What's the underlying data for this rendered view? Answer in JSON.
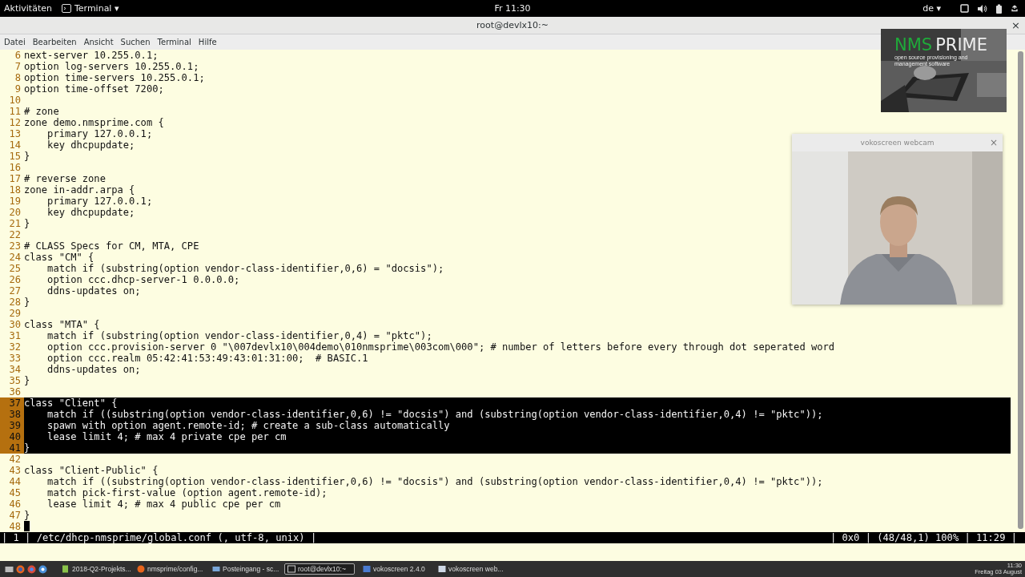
{
  "top_bar": {
    "activities": "Aktivitäten",
    "app_menu": "Terminal",
    "app_menu_caret": "▾",
    "clock": "Fr 11:30",
    "keyboard_layout": "de",
    "keyboard_caret": "▾"
  },
  "window": {
    "title": "root@devlx10:~",
    "close": "×"
  },
  "menu": [
    "Datei",
    "Bearbeiten",
    "Ansicht",
    "Suchen",
    "Terminal",
    "Hilfe"
  ],
  "editor": {
    "lines": [
      {
        "number": "6",
        "text": "next-server 10.255.0.1;",
        "selected": false,
        "cursor": false
      },
      {
        "number": "7",
        "text": "option log-servers 10.255.0.1;",
        "selected": false,
        "cursor": false
      },
      {
        "number": "8",
        "text": "option time-servers 10.255.0.1;",
        "selected": false,
        "cursor": false
      },
      {
        "number": "9",
        "text": "option time-offset 7200;",
        "selected": false,
        "cursor": false
      },
      {
        "number": "10",
        "selected": false,
        "cursor": false
      },
      {
        "number": "11",
        "text": "# zone",
        "selected": false,
        "cursor": false
      },
      {
        "number": "12",
        "text": "zone demo.nmsprime.com {",
        "selected": false,
        "cursor": false
      },
      {
        "number": "13",
        "text": "    primary 127.0.0.1;",
        "selected": false,
        "cursor": false
      },
      {
        "number": "14",
        "text": "    key dhcpupdate;",
        "selected": false,
        "cursor": false
      },
      {
        "number": "15",
        "text": "}",
        "selected": false,
        "cursor": false
      },
      {
        "number": "16",
        "selected": false,
        "cursor": false
      },
      {
        "number": "17",
        "text": "# reverse zone",
        "selected": false,
        "cursor": false
      },
      {
        "number": "18",
        "text": "zone in-addr.arpa {",
        "selected": false,
        "cursor": false
      },
      {
        "number": "19",
        "text": "    primary 127.0.0.1;",
        "selected": false,
        "cursor": false
      },
      {
        "number": "20",
        "text": "    key dhcpupdate;",
        "selected": false,
        "cursor": false
      },
      {
        "number": "21",
        "text": "}",
        "selected": false,
        "cursor": false
      },
      {
        "number": "22",
        "selected": false,
        "cursor": false
      },
      {
        "number": "23",
        "text": "# CLASS Specs for CM, MTA, CPE",
        "selected": false,
        "cursor": false
      },
      {
        "number": "24",
        "text": "class \"CM\" {",
        "selected": false,
        "cursor": false
      },
      {
        "number": "25",
        "text": "    match if (substring(option vendor-class-identifier,0,6) = \"docsis\");",
        "selected": false,
        "cursor": false
      },
      {
        "number": "26",
        "text": "    option ccc.dhcp-server-1 0.0.0.0;",
        "selected": false,
        "cursor": false
      },
      {
        "number": "27",
        "text": "    ddns-updates on;",
        "selected": false,
        "cursor": false
      },
      {
        "number": "28",
        "text": "}",
        "selected": false,
        "cursor": false
      },
      {
        "number": "29",
        "selected": false,
        "cursor": false
      },
      {
        "number": "30",
        "text": "class \"MTA\" {",
        "selected": false,
        "cursor": false
      },
      {
        "number": "31",
        "text": "    match if (substring(option vendor-class-identifier,0,4) = \"pktc\");",
        "selected": false,
        "cursor": false
      },
      {
        "number": "32",
        "text": "    option ccc.provision-server 0 \"\\007devlx10\\004demo\\010nmsprime\\003com\\000\"; # number of letters before every through dot seperated word",
        "selected": false,
        "cursor": false
      },
      {
        "number": "33",
        "text": "    option ccc.realm 05:42:41:53:49:43:01:31:00;  # BASIC.1",
        "selected": false,
        "cursor": false
      },
      {
        "number": "34",
        "text": "    ddns-updates on;",
        "selected": false,
        "cursor": false
      },
      {
        "number": "35",
        "text": "}",
        "selected": false,
        "cursor": false
      },
      {
        "number": "36",
        "selected": false,
        "cursor": false
      },
      {
        "number": "37",
        "text": "class \"Client\" {",
        "selected": true,
        "cursor": false
      },
      {
        "number": "38",
        "text": "    match if ((substring(option vendor-class-identifier,0,6) != \"docsis\") and (substring(option vendor-class-identifier,0,4) != \"pktc\"));",
        "selected": true,
        "cursor": false
      },
      {
        "number": "39",
        "text": "    spawn with option agent.remote-id; # create a sub-class automatically",
        "selected": true,
        "cursor": false
      },
      {
        "number": "40",
        "text": "    lease limit 4; # max 4 private cpe per cm",
        "selected": true,
        "cursor": false
      },
      {
        "number": "41",
        "text": "}",
        "selected": true,
        "cursor": false
      },
      {
        "number": "42",
        "selected": false,
        "cursor": false
      },
      {
        "number": "43",
        "text": "class \"Client-Public\" {",
        "selected": false,
        "cursor": false
      },
      {
        "number": "44",
        "text": "    match if ((substring(option vendor-class-identifier,0,6) != \"docsis\") and (substring(option vendor-class-identifier,0,4) != \"pktc\"));",
        "selected": false,
        "cursor": false
      },
      {
        "number": "45",
        "text": "    match pick-first-value (option agent.remote-id);",
        "selected": false,
        "cursor": false
      },
      {
        "number": "46",
        "text": "    lease limit 4; # max 4 public cpe per cm",
        "selected": false,
        "cursor": false
      },
      {
        "number": "47",
        "text": "}",
        "selected": false,
        "cursor": false
      },
      {
        "number": "48",
        "selected": false,
        "cursor": true
      }
    ]
  },
  "status_line": {
    "left": "| 1 | /etc/dhcp-nmsprime/global.conf (, utf-8, unix) |",
    "right": "| 0x0 | (48/48,1) 100% | 11:29 |"
  },
  "logo": {
    "accent": "NMS",
    "name": "PRIME",
    "tagline": "open source provisioning and management software"
  },
  "webcam_window": {
    "title": "vokoscreen webcam",
    "close": "×"
  },
  "taskbar": {
    "tasks": [
      {
        "label": "2018-Q2-Projekts...",
        "kind": "document",
        "selected": false
      },
      {
        "label": "nmsprime/config...",
        "kind": "browser",
        "selected": false
      },
      {
        "label": "Posteingang - sc...",
        "kind": "mail",
        "selected": false
      },
      {
        "label": "root@devlx10:~",
        "kind": "terminal",
        "selected": true
      },
      {
        "label": "vokoscreen 2.4.0",
        "kind": "recorder",
        "selected": false
      },
      {
        "label": "vokoscreen web...",
        "kind": "window",
        "selected": false
      }
    ],
    "clock": "11:30",
    "date": "Freitag 03 August"
  }
}
